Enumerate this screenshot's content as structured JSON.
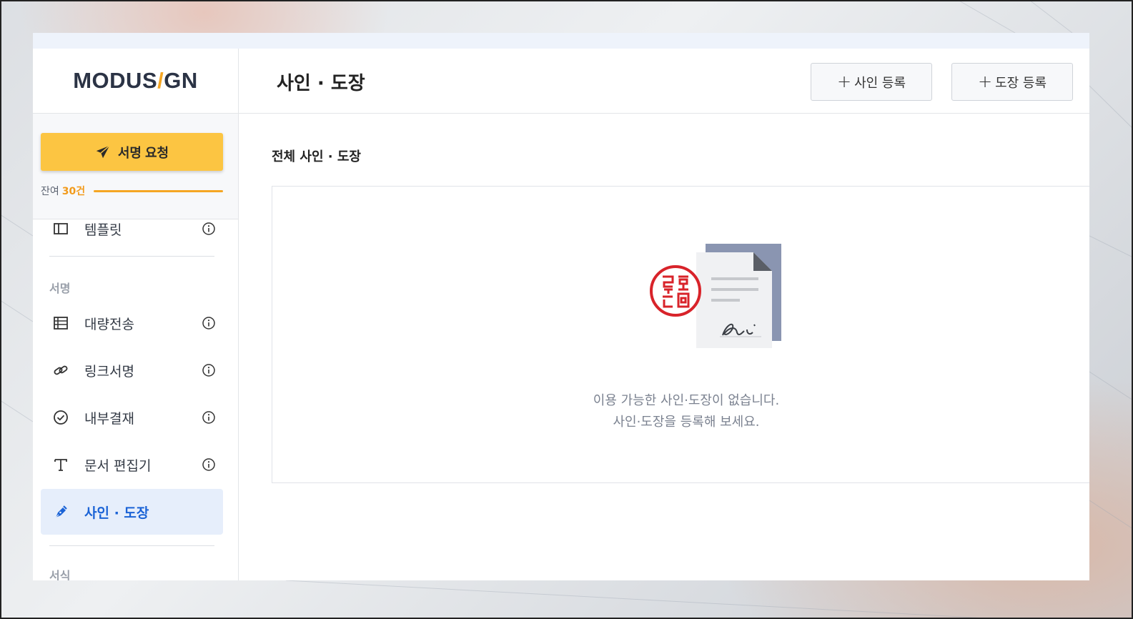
{
  "logo": {
    "left": "MODUS",
    "slash": "/",
    "right": "GN"
  },
  "sidebar": {
    "cta_label": "서명 요청",
    "remain_label": "잔여",
    "remain_count": "30건",
    "items": [
      {
        "label": "템플릿",
        "icon": "template-icon"
      },
      {
        "label": "대량전송",
        "icon": "table-icon"
      },
      {
        "label": "링크서명",
        "icon": "link-icon"
      },
      {
        "label": "내부결재",
        "icon": "check-circle-icon"
      },
      {
        "label": "문서 편집기",
        "icon": "text-icon"
      },
      {
        "label": "사인 · 도장",
        "icon": "pen-icon",
        "active": true
      }
    ],
    "sections": [
      "서명",
      "서식"
    ]
  },
  "header": {
    "title": "사인 · 도장",
    "buttons": [
      {
        "plus": "+",
        "label": "사인 등록"
      },
      {
        "plus": "+",
        "label": "도장 등록"
      }
    ]
  },
  "main": {
    "section_title": "전체 사인 · 도장",
    "empty_line1": "이용 가능한 사인·도장이 없습니다.",
    "empty_line2": "사인·도장을 등록해 보세요."
  },
  "colors": {
    "accent_yellow": "#fcc542",
    "active_blue": "#1b63d6",
    "active_bg": "#e6eefb",
    "remain_orange": "#f5a623"
  }
}
